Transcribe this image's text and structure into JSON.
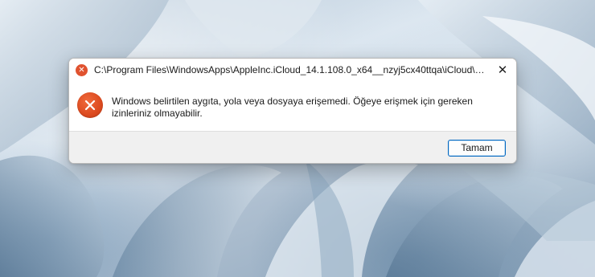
{
  "dialog": {
    "title": "C:\\Program Files\\WindowsApps\\AppleInc.iCloud_14.1.108.0_x64__nzyj5cx40ttqa\\iCloud\\We...",
    "close_symbol": "✕",
    "title_icon_symbol": "✕",
    "message": "Windows belirtilen aygıta, yola veya dosyaya erişemedi.  Öğeye erişmek için gereken izinleriniz olmayabilir.",
    "ok_label": "Tamam",
    "icon": "error-icon"
  },
  "colors": {
    "error_red": "#dc4a1f",
    "button_border": "#0067c0",
    "footer_bg": "#f0f0f0"
  }
}
